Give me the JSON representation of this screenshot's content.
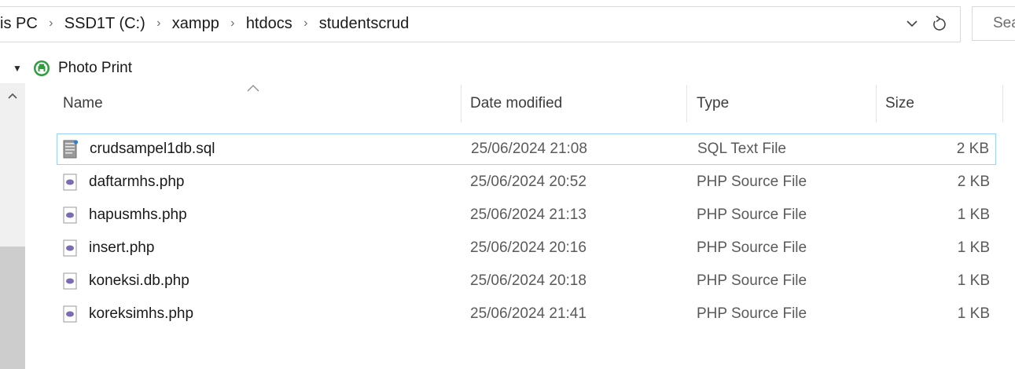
{
  "address_bar": {
    "breadcrumbs": [
      "is PC",
      "SSD1T (C:)",
      "xampp",
      "htdocs",
      "studentscrud"
    ],
    "history_icon": "chevron-down-icon",
    "refresh_icon": "refresh-icon",
    "search_placeholder": "Sea"
  },
  "nav_pane": {
    "item_label": "Photo Print",
    "item_icon": "photo-print-icon",
    "expander_icon": "expand-arrow-icon"
  },
  "columns": {
    "name": "Name",
    "date": "Date modified",
    "type": "Type",
    "size": "Size"
  },
  "files": [
    {
      "name": "crudsampel1db.sql",
      "date": "25/06/2024 21:08",
      "type": "SQL Text File",
      "size": "2 KB",
      "icon": "sql-file-icon",
      "selected": true
    },
    {
      "name": "daftarmhs.php",
      "date": "25/06/2024 20:52",
      "type": "PHP Source File",
      "size": "2 KB",
      "icon": "php-file-icon"
    },
    {
      "name": "hapusmhs.php",
      "date": "25/06/2024 21:13",
      "type": "PHP Source File",
      "size": "1 KB",
      "icon": "php-file-icon"
    },
    {
      "name": "insert.php",
      "date": "25/06/2024 20:16",
      "type": "PHP Source File",
      "size": "1 KB",
      "icon": "php-file-icon"
    },
    {
      "name": "koneksi.db.php",
      "date": "25/06/2024 20:18",
      "type": "PHP Source File",
      "size": "1 KB",
      "icon": "php-file-icon"
    },
    {
      "name": "koreksimhs.php",
      "date": "25/06/2024 21:41",
      "type": "PHP Source File",
      "size": "1 KB",
      "icon": "php-file-icon"
    }
  ],
  "colors": {
    "selection_border": "#99d1ff",
    "photo_print_green": "#2e9e3c",
    "php_icon_purple": "#7b6bb2"
  }
}
